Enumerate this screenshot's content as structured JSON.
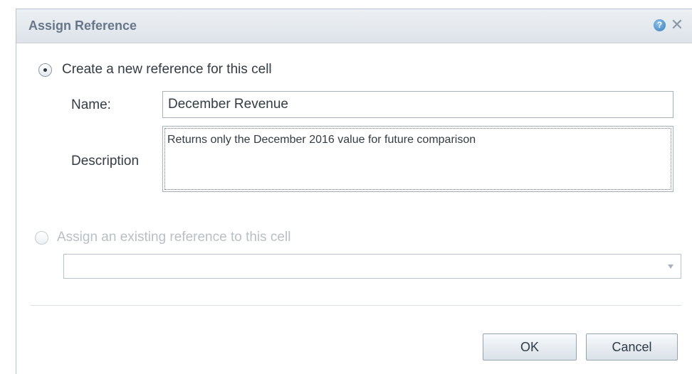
{
  "dialog": {
    "title": "Assign Reference",
    "help_icon": "help-icon",
    "help_glyph": "?",
    "close_icon": "close-icon",
    "close_glyph": "✕"
  },
  "create_option": {
    "label": "Create a new reference for this cell",
    "selected": true,
    "name_label": "Name:",
    "name_value": "December Revenue",
    "description_label": "Description",
    "description_value": "Returns only the December 2016 value for future comparison"
  },
  "assign_option": {
    "label": "Assign an existing reference to this cell",
    "selected": false,
    "disabled": true,
    "select_value": "",
    "dropdown_icon": "chevron-down-icon"
  },
  "buttons": {
    "ok_label": "OK",
    "cancel_label": "Cancel"
  },
  "colors": {
    "title_text": "#67768a",
    "titlebar_top": "#ecf0f4",
    "titlebar_bottom": "#dde3e9",
    "disabled_text": "#b8bfc7",
    "help_icon_blue": "#4e90cc"
  }
}
